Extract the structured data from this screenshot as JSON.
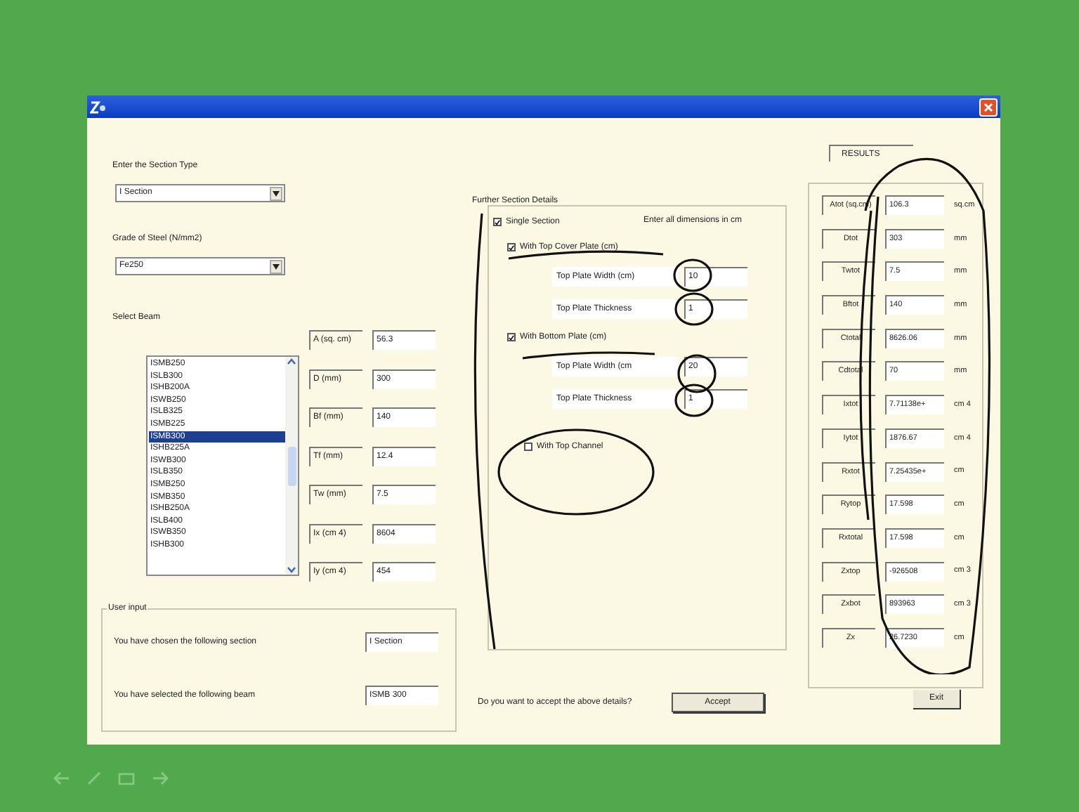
{
  "section_type": {
    "label": "Enter the Section Type",
    "value": "I Section"
  },
  "steel_grade": {
    "label": "Grade of Steel (N/mm2)",
    "value": "Fe250"
  },
  "beam_list": {
    "label": "Select Beam",
    "items": [
      {
        "label": "ISMB250",
        "selected": false
      },
      {
        "label": "ISLB300",
        "selected": false
      },
      {
        "label": "ISHB200A",
        "selected": false
      },
      {
        "label": "ISWB250",
        "selected": false
      },
      {
        "label": "ISLB325",
        "selected": false
      },
      {
        "label": "ISMB225",
        "selected": false
      },
      {
        "label": "ISMB300",
        "selected": true
      },
      {
        "label": "ISHB225A",
        "selected": false
      },
      {
        "label": "ISWB300",
        "selected": false
      },
      {
        "label": "ISLB350",
        "selected": false
      },
      {
        "label": "ISMB250",
        "selected": false
      },
      {
        "label": "ISMB350",
        "selected": false
      },
      {
        "label": "ISHB250A",
        "selected": false
      },
      {
        "label": "ISLB400",
        "selected": false
      },
      {
        "label": "ISWB350",
        "selected": false
      },
      {
        "label": "ISHB300",
        "selected": false
      }
    ]
  },
  "properties": [
    {
      "label": "A (sq. cm)",
      "value": "56.3"
    },
    {
      "label": "D (mm)",
      "value": "300"
    },
    {
      "label": "Bf (mm)",
      "value": "140"
    },
    {
      "label": "Tf (mm)",
      "value": "12.4"
    },
    {
      "label": "Tw (mm)",
      "value": "7.5"
    },
    {
      "label": "Ix (cm 4)",
      "value": "8604"
    },
    {
      "label": "Iy (cm 4)",
      "value": "454"
    }
  ],
  "user_input": {
    "title": "User input",
    "rows": [
      {
        "label": "You have chosen the following section",
        "value": "I Section"
      },
      {
        "label": "You have selected the following beam",
        "value": "ISMB 300"
      }
    ]
  },
  "further_details": {
    "title": "Further Section Details",
    "note": "Enter all dimensions in cm",
    "items": [
      {
        "kind": "checkbox",
        "label": "Single Section",
        "checked": true,
        "children": [
          {
            "kind": "checkbox",
            "label": "With Top Cover Plate (cm)",
            "checked": true,
            "children": [
              {
                "kind": "field",
                "label": "Top Plate Width (cm)",
                "value": "10"
              },
              {
                "kind": "field",
                "label": "Top Plate Thickness",
                "value": "1"
              }
            ]
          },
          {
            "kind": "checkbox",
            "label": "With Bottom Plate (cm)",
            "checked": true,
            "children": [
              {
                "kind": "field",
                "label": "Top Plate Width (cm",
                "value": "20"
              },
              {
                "kind": "field",
                "label": "Top Plate Thickness",
                "value": "1"
              }
            ]
          },
          {
            "kind": "checkbox",
            "label": "With Top Channel",
            "checked": false
          }
        ]
      }
    ]
  },
  "prompt": "Do you want to accept the above details?",
  "accept_button": "Accept",
  "results": {
    "title": "RESULTS",
    "rows": [
      {
        "label": "Atot (sq.cm)",
        "value": "106.3",
        "unit": "sq.cm"
      },
      {
        "label": "Dtot",
        "value": "303",
        "unit": "mm"
      },
      {
        "label": "Twtot",
        "value": "7.5",
        "unit": "mm"
      },
      {
        "label": "Bftot",
        "value": "140",
        "unit": "mm"
      },
      {
        "label": "Ctotal",
        "value": "8626.06",
        "unit": "mm"
      },
      {
        "label": "Cdtotal",
        "value": "70",
        "unit": "mm"
      },
      {
        "label": "Ixtot",
        "value": "7.71138e+",
        "unit": "cm 4"
      },
      {
        "label": "Iytot",
        "value": "1876.67",
        "unit": "cm 4"
      },
      {
        "label": "Rxtot",
        "value": "7.25435e+",
        "unit": "cm"
      },
      {
        "label": "Rytop",
        "value": "17.598",
        "unit": "cm"
      },
      {
        "label": "Rxtotal",
        "value": "17.598",
        "unit": "cm"
      },
      {
        "label": "Zxtop",
        "value": "-926508",
        "unit": "cm 3"
      },
      {
        "label": "Zxbot",
        "value": "893963",
        "unit": "cm 3"
      },
      {
        "label": "Zx",
        "value": "26.7230",
        "unit": "cm"
      }
    ]
  },
  "exit_button": "Exit"
}
